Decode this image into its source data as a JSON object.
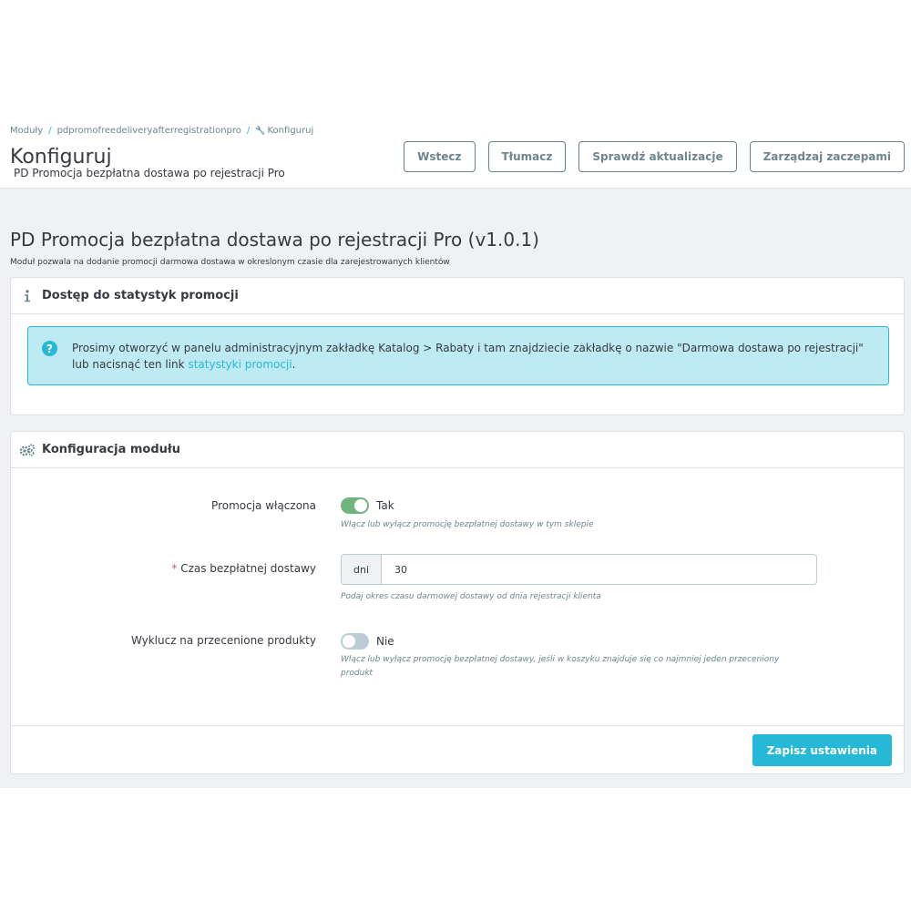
{
  "breadcrumb": {
    "items": [
      "Moduły",
      "pdpromofreedeliveryafterregistrationpro",
      "Konfiguruj"
    ],
    "separator": "/"
  },
  "header": {
    "title": "Konfiguruj",
    "subtitle": "PD Promocja bezpłatna dostawa po rejestracji Pro",
    "buttons": [
      "Wstecz",
      "Tłumacz",
      "Sprawdź aktualizacje",
      "Zarządzaj zaczepami"
    ]
  },
  "module": {
    "title": "PD Promocja bezpłatna dostawa po rejestracji Pro (v1.0.1)",
    "description": "Moduł pozwala na dodanie promocji darmowa dostawa w okreslonym czasie dla zarejestrowanych klientów"
  },
  "stats_panel": {
    "title": "Dostęp do statystyk promocji",
    "alert_icon": "?",
    "alert_text": "Prosimy otworzyć w panelu administracyjnym zakładkę Katalog > Rabaty i tam znajdziecie zakładkę o nazwie \"Darmowa dostawa po rejestracji\" lub nacisnąć ten link",
    "alert_link": "statystyki promocji",
    "alert_end": "."
  },
  "config_panel": {
    "title": "Konfiguracja modułu",
    "fields": {
      "promo_enabled": {
        "label": "Promocja włączona",
        "value": true,
        "value_label": "Tak",
        "help": "Włącz lub wyłącz promocję bezpłatnej dostawy w tym sklepie"
      },
      "free_time": {
        "required_mark": "*",
        "label": "Czas bezpłatnej dostawy",
        "prefix": "dni",
        "value": "30",
        "help": "Podaj okres czasu darmowej dostawy od dnia rejestracji klienta"
      },
      "exclude_discounted": {
        "label": "Wyklucz na przecenione produkty",
        "value": false,
        "value_label": "Nie",
        "help": "Włącz lub wyłącz promocję bezpłatnej dostawy, jeśli w koszyku znajduje się co najmniej jeden przeceniony produkt"
      }
    },
    "save_label": "Zapisz ustawienia"
  },
  "colors": {
    "accent": "#25b9d7",
    "switch_on": "#70b580",
    "switch_off": "#bbcdd2",
    "alert_bg": "#beeaf3",
    "content_bg": "#eff1f2"
  },
  "icons": {
    "info": "info-icon",
    "gears": "gears-icon",
    "question": "question-circle-icon",
    "wrench": "wrench-icon"
  }
}
